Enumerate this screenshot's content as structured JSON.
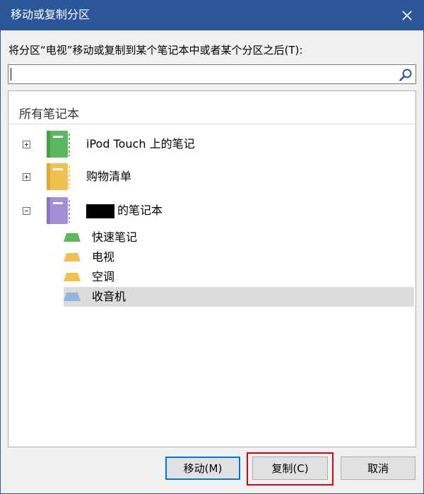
{
  "dialog": {
    "title": "移动或复制分区",
    "prompt": "将分区“电视”移动或复制到某个笔记本中或者某个分区之后(T):",
    "search": {
      "value": "",
      "placeholder": ""
    },
    "tree_header": "所有笔记本",
    "notebooks": [
      {
        "label": "iPod Touch 上的笔记",
        "color": "#5cb85c",
        "expanded": false
      },
      {
        "label": "购物清单",
        "color": "#f0c050",
        "expanded": false
      },
      {
        "label": "的笔记本",
        "color": "#a58ed6",
        "expanded": true,
        "redacted_prefix": true
      }
    ],
    "sections": [
      {
        "label": "快速笔记",
        "color": "#5cb85c",
        "selected": false
      },
      {
        "label": "电视",
        "color": "#f0c050",
        "selected": false
      },
      {
        "label": "空调",
        "color": "#f0c050",
        "selected": false
      },
      {
        "label": "收音机",
        "color": "#8fb8e0",
        "selected": true
      }
    ],
    "buttons": {
      "move": "移动(M)",
      "copy": "复制(C)",
      "cancel": "取消"
    },
    "colors": {
      "accent": "#2b579a",
      "selection": "#dcdcdc",
      "highlight": "#d0021b"
    }
  }
}
